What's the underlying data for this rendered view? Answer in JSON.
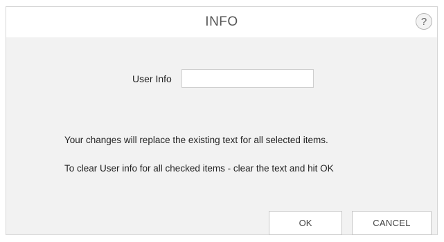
{
  "dialog": {
    "title": "INFO",
    "help_label": "?"
  },
  "form": {
    "user_info_label": "User Info",
    "user_info_value": "",
    "user_info_placeholder": ""
  },
  "messages": {
    "replace_notice": "Your changes will replace the existing text for all selected items.",
    "clear_notice": "To clear User info for all checked items - clear the text and hit OK"
  },
  "buttons": {
    "ok_label": "OK",
    "cancel_label": "CANCEL"
  }
}
